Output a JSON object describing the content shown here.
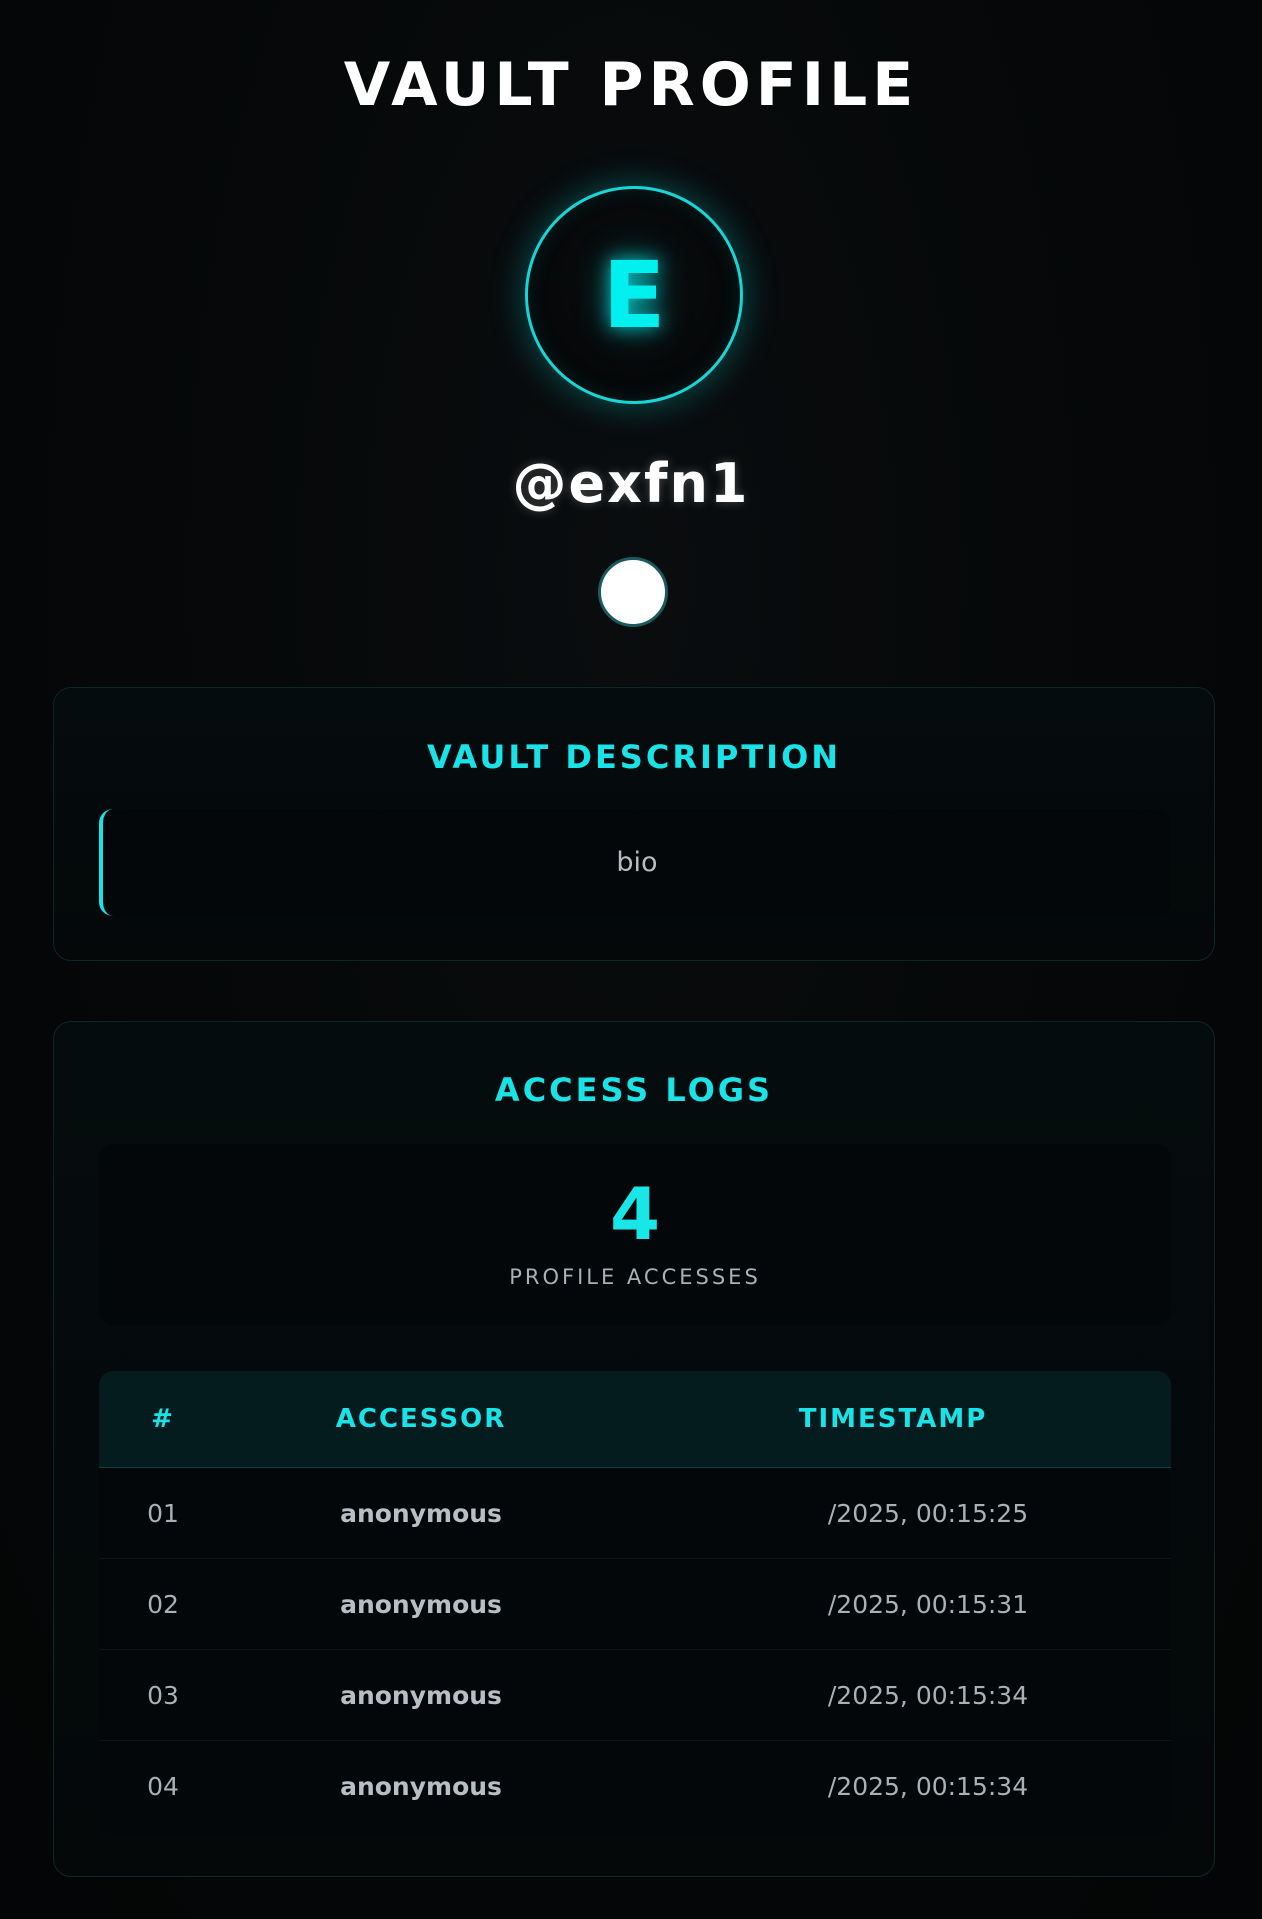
{
  "header": {
    "title": "VAULT PROFILE"
  },
  "profile": {
    "avatar_letter": "E",
    "username": "@exfn1",
    "accent_color": "#19e3e6"
  },
  "description": {
    "heading": "VAULT DESCRIPTION",
    "bio": "bio"
  },
  "logs": {
    "heading": "ACCESS LOGS",
    "count": "4",
    "count_label": "PROFILE ACCESSES",
    "columns": [
      "#",
      "ACCESSOR",
      "TIMESTAMP"
    ],
    "rows": [
      {
        "num": "01",
        "accessor": "anonymous",
        "timestamp": "/2025, 00:15:25"
      },
      {
        "num": "02",
        "accessor": "anonymous",
        "timestamp": "/2025, 00:15:31"
      },
      {
        "num": "03",
        "accessor": "anonymous",
        "timestamp": "/2025, 00:15:34"
      },
      {
        "num": "04",
        "accessor": "anonymous",
        "timestamp": "/2025, 00:15:34"
      }
    ]
  }
}
